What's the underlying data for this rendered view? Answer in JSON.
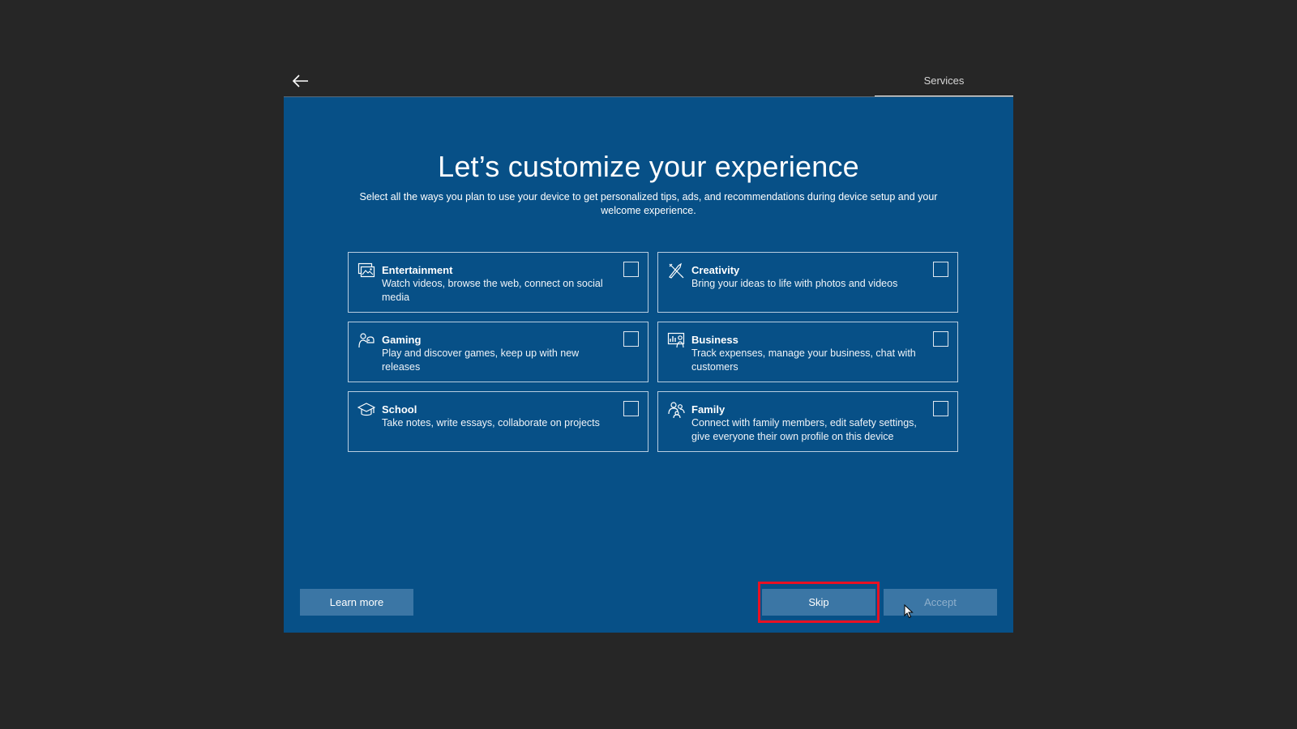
{
  "header": {
    "tab_label": "Services"
  },
  "main": {
    "title": "Let’s customize your experience",
    "subtitle": "Select all the ways you plan to use your device to get personalized tips, ads, and recommendations during device setup and your welcome experience.",
    "options": [
      {
        "name": "Entertainment",
        "description": "Watch videos, browse the web, connect on social media",
        "icon": "entertainment-icon",
        "checked": false
      },
      {
        "name": "Creativity",
        "description": "Bring your ideas to life with photos and videos",
        "icon": "creativity-icon",
        "checked": false
      },
      {
        "name": "Gaming",
        "description": "Play and discover games, keep up with new releases",
        "icon": "gaming-icon",
        "checked": false
      },
      {
        "name": "Business",
        "description": "Track expenses, manage your business, chat with customers",
        "icon": "business-icon",
        "checked": false
      },
      {
        "name": "School",
        "description": "Take notes, write essays, collaborate on projects",
        "icon": "school-icon",
        "checked": false
      },
      {
        "name": "Family",
        "description": "Connect with family members, edit safety settings, give everyone their own profile on this device",
        "icon": "family-icon",
        "checked": false
      }
    ]
  },
  "footer": {
    "learn_more_label": "Learn more",
    "skip_label": "Skip",
    "accept_label": "Accept"
  },
  "colors": {
    "background": "#262626",
    "panel": "#075087",
    "button": "#3b76a5",
    "highlight": "#e81123"
  }
}
